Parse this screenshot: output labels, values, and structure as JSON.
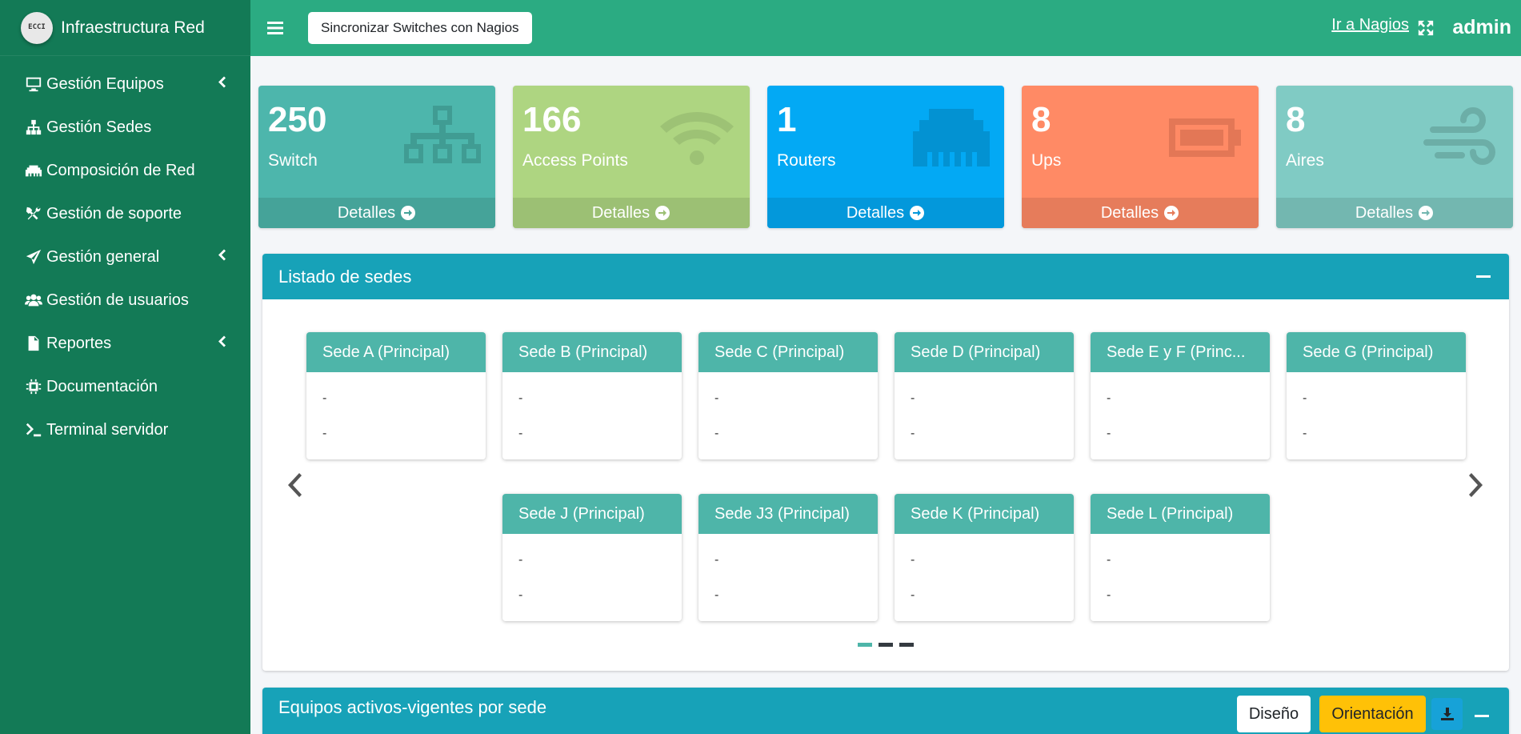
{
  "brand": {
    "title": "Infraestructura Red",
    "logo_text": "ECCI"
  },
  "sidebar": {
    "items": [
      {
        "label": "Gestión Equipos",
        "icon": "desktop-icon",
        "has_submenu": true
      },
      {
        "label": "Gestión Sedes",
        "icon": "sitemap-icon",
        "has_submenu": false
      },
      {
        "label": "Composición de Red",
        "icon": "ethernet-icon",
        "has_submenu": false
      },
      {
        "label": "Gestión de soporte",
        "icon": "tools-icon",
        "has_submenu": false
      },
      {
        "label": "Gestión general",
        "icon": "paper-plane-icon",
        "has_submenu": true
      },
      {
        "label": "Gestión de usuarios",
        "icon": "users-icon",
        "has_submenu": false
      },
      {
        "label": "Reportes",
        "icon": "file-icon",
        "has_submenu": true
      },
      {
        "label": "Documentación",
        "icon": "chip-icon",
        "has_submenu": false
      },
      {
        "label": "Terminal servidor",
        "icon": "terminal-icon",
        "has_submenu": false
      }
    ]
  },
  "topbar": {
    "sync_button": "Sincronizar Switches con Nagios",
    "nagios_link": "Ir a Nagios",
    "user": "admin"
  },
  "stats": [
    {
      "value": "250",
      "label": "Switch",
      "footer": "Detalles",
      "color": "#4db6ac",
      "footer_color": "#45a399",
      "icon": "network-icon"
    },
    {
      "value": "166",
      "label": "Access Points",
      "footer": "Detalles",
      "color": "#aed581",
      "footer_color": "#9cc074",
      "icon": "wifi-icon"
    },
    {
      "value": "1",
      "label": "Routers",
      "footer": "Detalles",
      "color": "#03a9f4",
      "footer_color": "#0398db",
      "icon": "ethernet-icon"
    },
    {
      "value": "8",
      "label": "Ups",
      "footer": "Detalles",
      "color": "#ff8a65",
      "footer_color": "#e67c5b",
      "icon": "battery-icon"
    },
    {
      "value": "8",
      "label": "Aires",
      "footer": "Detalles",
      "color": "#80cbc4",
      "footer_color": "#73b7b0",
      "icon": "wind-icon"
    }
  ],
  "sedes_card": {
    "title": "Listado de sedes",
    "sedes": [
      {
        "name": "Sede A (Principal)",
        "line1": "-",
        "line2": "-"
      },
      {
        "name": "Sede B (Principal)",
        "line1": "-",
        "line2": "-"
      },
      {
        "name": "Sede C (Principal)",
        "line1": "-",
        "line2": "-"
      },
      {
        "name": "Sede D (Principal)",
        "line1": "-",
        "line2": "-"
      },
      {
        "name": "Sede E y F (Princ...",
        "line1": "-",
        "line2": "-"
      },
      {
        "name": "Sede G (Principal)",
        "line1": "-",
        "line2": "-"
      },
      {
        "name": "Sede J (Principal)",
        "line1": "-",
        "line2": "-"
      },
      {
        "name": "Sede J3 (Principal)",
        "line1": "-",
        "line2": "-"
      },
      {
        "name": "Sede K (Principal)",
        "line1": "-",
        "line2": "-"
      },
      {
        "name": "Sede L (Principal)",
        "line1": "-",
        "line2": "-"
      }
    ],
    "active_page": 1,
    "pages": 3
  },
  "equipos_card": {
    "title": "Equipos activos-vigentes por sede",
    "design_button": "Diseño",
    "orientation_button": "Orientación"
  },
  "colors": {
    "sidebar": "#137a56",
    "topbar": "#2bab82",
    "card_header": "#17a2b8",
    "sede_header": "#4eb5a9",
    "orientation": "#ffc107"
  }
}
